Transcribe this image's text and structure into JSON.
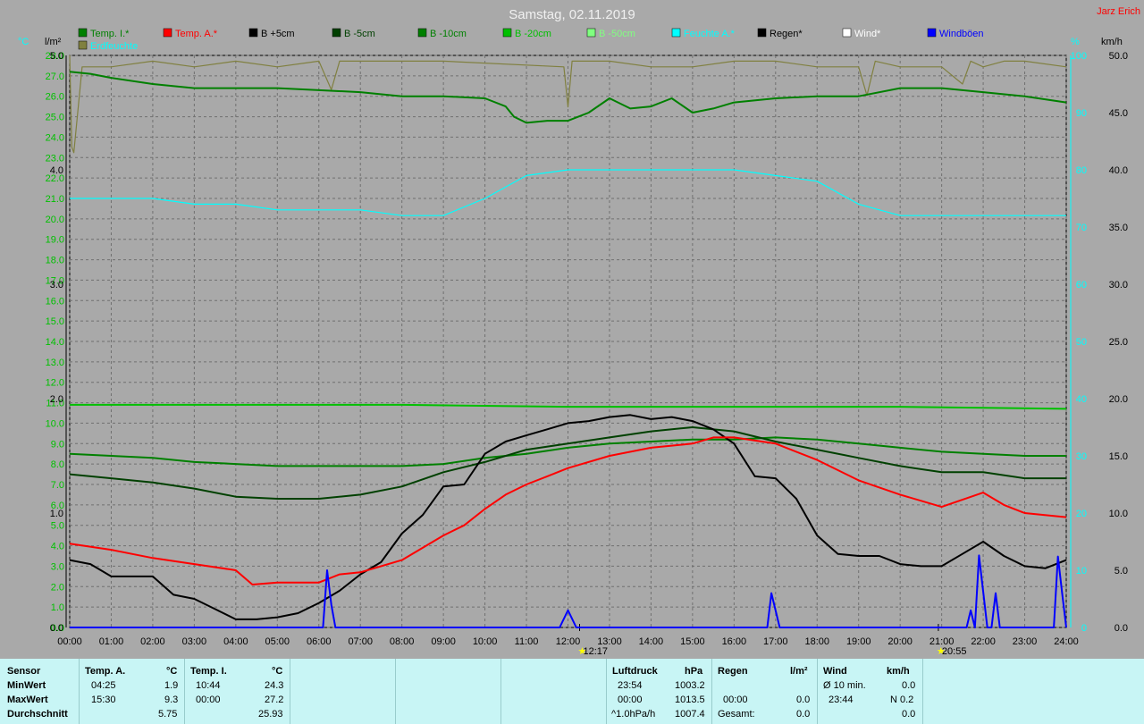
{
  "title": "Samstag, 02.11.2019",
  "author": "Jarz Erich",
  "units": {
    "left_temp": "°C",
    "left_rain": "l/m²",
    "right_pct": "%",
    "right_wind": "km/h"
  },
  "legend_row1": [
    {
      "name": "Temp. I.*",
      "color": "#008000"
    },
    {
      "name": "Temp. A.*",
      "color": "#ff0000"
    },
    {
      "name": "B +5cm",
      "color": "#000000"
    },
    {
      "name": "B -5cm",
      "color": "#004000"
    },
    {
      "name": "B -10cm",
      "color": "#008000"
    },
    {
      "name": "B -20cm",
      "color": "#00c000"
    },
    {
      "name": "B -50cm",
      "color": "#80ff80"
    },
    {
      "name": "Feuchte A.*",
      "color": "#00ffff"
    },
    {
      "name": "Regen*",
      "color": "#000000"
    },
    {
      "name": "Wind*",
      "color": "#ffffff"
    },
    {
      "name": "Windböen",
      "color": "#0000ff"
    }
  ],
  "legend_row2": [
    {
      "name": "Erdfeuchte",
      "color": "#808040"
    }
  ],
  "chart_data": {
    "type": "line",
    "x_range": [
      "00:00",
      "24:00"
    ],
    "x_ticks": [
      "00:00",
      "01:00",
      "02:00",
      "03:00",
      "04:00",
      "05:00",
      "06:00",
      "07:00",
      "08:00",
      "09:00",
      "10:00",
      "11:00",
      "12:00",
      "13:00",
      "14:00",
      "15:00",
      "16:00",
      "17:00",
      "18:00",
      "19:00",
      "20:00",
      "21:00",
      "22:00",
      "23:00",
      "24:00"
    ],
    "y_temp": {
      "range": [
        0,
        28
      ],
      "ticks": [
        "0.0",
        "1.0",
        "2.0",
        "3.0",
        "4.0",
        "5.0",
        "6.0",
        "7.0",
        "8.0",
        "9.0",
        "10.0",
        "11.0",
        "12.0",
        "13.0",
        "14.0",
        "15.0",
        "16.0",
        "17.0",
        "18.0",
        "19.0",
        "20.0",
        "21.0",
        "22.0",
        "23.0",
        "24.0",
        "25.0",
        "26.0",
        "27.0",
        "28.0"
      ]
    },
    "y_rain": {
      "range": [
        0,
        5
      ],
      "ticks": [
        "0.0",
        "1.0",
        "2.0",
        "3.0",
        "4.0",
        "5.0"
      ]
    },
    "y_pct": {
      "range": [
        0,
        100
      ],
      "ticks": [
        "0",
        "10",
        "20",
        "30",
        "40",
        "50",
        "60",
        "70",
        "80",
        "90",
        "100"
      ]
    },
    "y_wind": {
      "range": [
        0,
        50
      ],
      "ticks": [
        "0.0",
        "5.0",
        "10.0",
        "15.0",
        "20.0",
        "25.0",
        "30.0",
        "35.0",
        "40.0",
        "45.0",
        "50.0"
      ]
    },
    "markers": [
      {
        "label": "12:17",
        "x": 12.28
      },
      {
        "label": "20:55",
        "x": 20.92
      }
    ],
    "series": [
      {
        "name": "Temp. I.*",
        "axis": "temp",
        "color": "#008000",
        "x": [
          0,
          0.5,
          1,
          2,
          3,
          4,
          5,
          6,
          7,
          8,
          9,
          10,
          10.5,
          10.7,
          11,
          11.5,
          12,
          12.5,
          13,
          13.5,
          14,
          14.5,
          15,
          15.5,
          16,
          17,
          18,
          19,
          20,
          21,
          22,
          23,
          24
        ],
        "y": [
          27.2,
          27.1,
          26.9,
          26.6,
          26.4,
          26.4,
          26.4,
          26.3,
          26.2,
          26.0,
          26.0,
          25.9,
          25.5,
          25.0,
          24.7,
          24.8,
          24.8,
          25.2,
          25.9,
          25.4,
          25.5,
          25.9,
          25.2,
          25.4,
          25.7,
          25.9,
          26.0,
          26.0,
          26.4,
          26.4,
          26.2,
          26.0,
          25.7
        ]
      },
      {
        "name": "Temp. A.*",
        "axis": "temp",
        "color": "#ff0000",
        "x": [
          0,
          1,
          2,
          3,
          4,
          4.4,
          5,
          6,
          6.5,
          7,
          8,
          8.5,
          9,
          9.5,
          10,
          10.5,
          11,
          11.5,
          12,
          13,
          14,
          15,
          15.5,
          16,
          17,
          18,
          19,
          20,
          21,
          22,
          22.5,
          23,
          24
        ],
        "y": [
          4.1,
          3.8,
          3.4,
          3.1,
          2.8,
          2.1,
          2.2,
          2.2,
          2.6,
          2.7,
          3.3,
          3.9,
          4.5,
          5.0,
          5.8,
          6.5,
          7.0,
          7.4,
          7.8,
          8.4,
          8.8,
          9.0,
          9.3,
          9.3,
          9.0,
          8.2,
          7.2,
          6.5,
          5.9,
          6.6,
          6.0,
          5.6,
          5.4
        ]
      },
      {
        "name": "B +5cm",
        "axis": "temp",
        "color": "#000000",
        "x": [
          0,
          0.5,
          1,
          2,
          2.5,
          3,
          3.5,
          4,
          4.5,
          5,
          5.5,
          6,
          6.5,
          7,
          7.5,
          8,
          8.5,
          9,
          9.5,
          10,
          10.5,
          11,
          11.5,
          12,
          12.5,
          13,
          13.5,
          14,
          14.5,
          15,
          15.5,
          16,
          16.5,
          17,
          17.5,
          18,
          18.5,
          19,
          19.5,
          20,
          20.5,
          21,
          21.5,
          22,
          22.5,
          23,
          23.5,
          24
        ],
        "y": [
          3.3,
          3.1,
          2.5,
          2.5,
          1.6,
          1.4,
          0.9,
          0.4,
          0.4,
          0.5,
          0.7,
          1.2,
          1.8,
          2.6,
          3.2,
          4.6,
          5.5,
          6.9,
          7.0,
          8.5,
          9.1,
          9.4,
          9.7,
          10.0,
          10.1,
          10.3,
          10.4,
          10.2,
          10.3,
          10.1,
          9.7,
          9.0,
          7.4,
          7.3,
          6.3,
          4.5,
          3.6,
          3.5,
          3.5,
          3.1,
          3.0,
          3.0,
          3.6,
          4.2,
          3.5,
          3.0,
          2.9,
          3.3
        ]
      },
      {
        "name": "B -5cm",
        "axis": "temp",
        "color": "#004000",
        "x": [
          0,
          1,
          2,
          3,
          4,
          5,
          6,
          7,
          8,
          9,
          10,
          11,
          12,
          13,
          14,
          15,
          16,
          17,
          18,
          19,
          20,
          21,
          22,
          23,
          24
        ],
        "y": [
          7.5,
          7.3,
          7.1,
          6.8,
          6.4,
          6.3,
          6.3,
          6.5,
          6.9,
          7.6,
          8.1,
          8.7,
          9.0,
          9.3,
          9.6,
          9.8,
          9.6,
          9.1,
          8.7,
          8.3,
          7.9,
          7.6,
          7.6,
          7.3,
          7.3
        ]
      },
      {
        "name": "B -10cm",
        "axis": "temp",
        "color": "#008000",
        "x": [
          0,
          1,
          2,
          3,
          4,
          5,
          6,
          7,
          8,
          9,
          10,
          11,
          12,
          13,
          14,
          15,
          16,
          17,
          18,
          19,
          20,
          21,
          22,
          23,
          24
        ],
        "y": [
          8.5,
          8.4,
          8.3,
          8.1,
          8.0,
          7.9,
          7.9,
          7.9,
          7.9,
          8.0,
          8.3,
          8.5,
          8.8,
          9.0,
          9.1,
          9.2,
          9.2,
          9.3,
          9.2,
          9.0,
          8.8,
          8.6,
          8.5,
          8.4,
          8.4
        ]
      },
      {
        "name": "B -20cm",
        "axis": "temp",
        "color": "#00c000",
        "x": [
          0,
          4,
          8,
          12,
          16,
          20,
          24
        ],
        "y": [
          10.9,
          10.9,
          10.9,
          10.8,
          10.8,
          10.8,
          10.7
        ]
      },
      {
        "name": "Feuchte A.*",
        "axis": "pct",
        "color": "#00ffff",
        "x": [
          0,
          1,
          2,
          3,
          4,
          5,
          6,
          7,
          8,
          9,
          10,
          11,
          12,
          13,
          14,
          15,
          16,
          17,
          18,
          19,
          20,
          21,
          22,
          23,
          24
        ],
        "y": [
          75,
          75,
          75,
          74,
          74,
          73,
          73,
          73,
          72,
          72,
          75,
          79,
          80,
          80,
          80,
          80,
          80,
          79,
          78,
          74,
          72,
          72,
          72,
          72,
          72
        ]
      },
      {
        "name": "Erdfeuchte",
        "axis": "pct",
        "color": "#808040",
        "x": [
          0,
          0.05,
          0.1,
          0.3,
          1,
          2,
          3,
          4,
          5,
          6,
          6.3,
          6.5,
          7,
          8,
          9,
          11.9,
          12,
          12.1,
          13,
          14,
          15,
          16,
          17,
          18,
          19,
          19.2,
          19.4,
          20,
          21,
          21.5,
          21.7,
          22,
          22.5,
          23,
          24
        ],
        "y": [
          100,
          84,
          83,
          98,
          98,
          99,
          98,
          99,
          98,
          99,
          94,
          99,
          99,
          99,
          99,
          98,
          91,
          99,
          99,
          98,
          98,
          99,
          99,
          98,
          98,
          93,
          99,
          98,
          98,
          95,
          99,
          98,
          99,
          99,
          98
        ]
      },
      {
        "name": "Windböen",
        "axis": "wind",
        "color": "#0000ff",
        "x": [
          0,
          6.1,
          6.2,
          6.3,
          6.4,
          6.5,
          11.8,
          12,
          12.2,
          16.8,
          16.9,
          17.1,
          21.6,
          21.7,
          21.8,
          21.9,
          22.1,
          22.2,
          22.3,
          22.4,
          23.7,
          23.8,
          23.9,
          24
        ],
        "y": [
          0,
          0,
          5,
          2,
          0,
          0,
          0,
          1.5,
          0,
          0,
          3,
          0,
          0,
          1.5,
          0,
          6.3,
          0,
          0,
          3,
          0,
          0,
          6.2,
          3,
          0
        ]
      }
    ]
  },
  "footer": {
    "sensor_head": "Sensor",
    "min_label": "MinWert",
    "max_label": "MaxWert",
    "avg_label": "Durchschnitt",
    "temp_a": {
      "label": "Temp. A.",
      "unit": "°C",
      "min_time": "04:25",
      "min_val": "1.9",
      "max_time": "15:30",
      "max_val": "9.3",
      "avg": "5.75"
    },
    "temp_i": {
      "label": "Temp. I.",
      "unit": "°C",
      "min_time": "10:44",
      "min_val": "24.3",
      "max_time": "00:00",
      "max_val": "27.2",
      "avg": "25.93"
    },
    "pressure": {
      "label": "Luftdruck",
      "unit": "hPa",
      "min_time": "23:54",
      "min_val": "1003.2",
      "max_time": "00:00",
      "max_val": "1013.5",
      "avg_label": "^1.0hPa/h",
      "avg": "1007.4"
    },
    "rain": {
      "label": "Regen",
      "unit": "l/m²",
      "min_time": "",
      "min_val": "",
      "max_time": "00:00",
      "max_val": "0.0",
      "avg_label": "Gesamt:",
      "avg": "0.0"
    },
    "wind": {
      "label": "Wind",
      "unit": "km/h",
      "min_time": "Ø 10 min.",
      "min_val": "0.0",
      "max_time": "23:44",
      "max_val": "N 0.2",
      "avg": "0.0"
    }
  }
}
